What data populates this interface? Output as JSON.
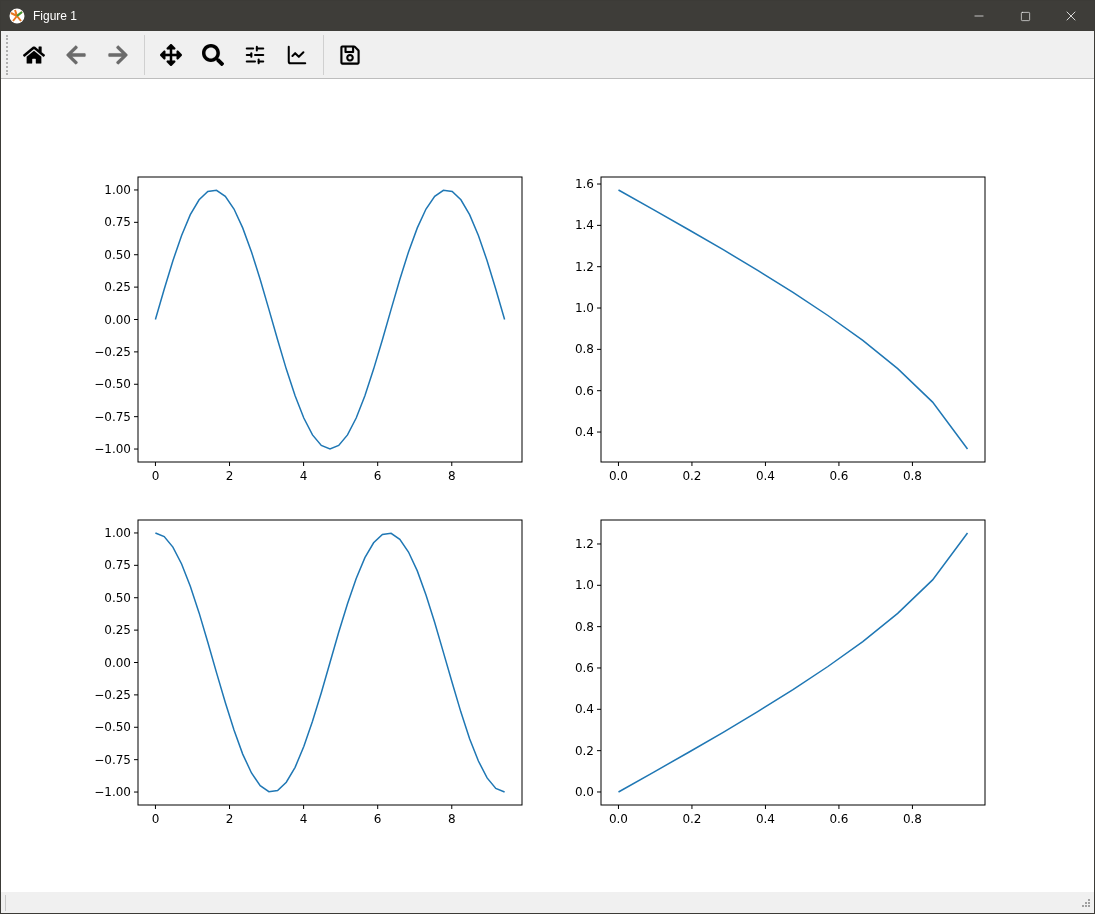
{
  "window": {
    "title": "Figure 1"
  },
  "toolbar": [
    {
      "kind": "home",
      "disabled": false
    },
    {
      "kind": "back",
      "disabled": true
    },
    {
      "kind": "forward",
      "disabled": true
    },
    {
      "kind": "separator"
    },
    {
      "kind": "pan",
      "disabled": false
    },
    {
      "kind": "zoom",
      "disabled": false
    },
    {
      "kind": "subplots",
      "disabled": false
    },
    {
      "kind": "axes",
      "disabled": false
    },
    {
      "kind": "separator"
    },
    {
      "kind": "save",
      "disabled": false
    }
  ],
  "plots": [
    {
      "chart_data": {
        "type": "line",
        "x": [
          0,
          0.236,
          0.471,
          0.707,
          0.942,
          1.178,
          1.414,
          1.649,
          1.885,
          2.121,
          2.356,
          2.592,
          2.827,
          3.063,
          3.299,
          3.534,
          3.77,
          4.006,
          4.241,
          4.477,
          4.712,
          4.948,
          5.184,
          5.419,
          5.655,
          5.89,
          6.126,
          6.362,
          6.597,
          6.833,
          7.069,
          7.304,
          7.54,
          7.775,
          8.011,
          8.247,
          8.482,
          8.718,
          8.954,
          9.189,
          9.425
        ],
        "series": [
          {
            "color": "#1f77b4",
            "values": [
              0,
              0.233,
              0.454,
              0.649,
              0.809,
              0.924,
              0.988,
              0.997,
              0.951,
              0.853,
              0.707,
              0.522,
              0.309,
              0.078,
              -0.156,
              -0.383,
              -0.588,
              -0.76,
              -0.891,
              -0.972,
              -1,
              -0.972,
              -0.891,
              -0.76,
              -0.588,
              -0.383,
              -0.156,
              0.078,
              0.309,
              0.522,
              0.707,
              0.853,
              0.951,
              0.997,
              0.988,
              0.924,
              0.809,
              0.649,
              0.454,
              0.233,
              0
            ]
          }
        ],
        "xlim": [
          -0.471,
          9.896
        ],
        "ylim": [
          -1.1,
          1.1
        ],
        "xticks": [
          {
            "value": 0,
            "label": "0"
          },
          {
            "value": 2,
            "label": "2"
          },
          {
            "value": 4,
            "label": "4"
          },
          {
            "value": 6,
            "label": "6"
          },
          {
            "value": 8,
            "label": "8"
          }
        ],
        "yticks": [
          {
            "value": 1,
            "label": "1.00"
          },
          {
            "value": 0.75,
            "label": "0.75"
          },
          {
            "value": 0.5,
            "label": "0.50"
          },
          {
            "value": 0.25,
            "label": "0.25"
          },
          {
            "value": 0,
            "label": "0.00"
          },
          {
            "value": -0.25,
            "label": "−0.25"
          },
          {
            "value": -0.5,
            "label": "−0.50"
          },
          {
            "value": -0.75,
            "label": "−0.75"
          },
          {
            "value": -1,
            "label": "−1.00"
          }
        ]
      }
    },
    {
      "chart_data": {
        "type": "line",
        "x": [
          0,
          0.095,
          0.19,
          0.285,
          0.38,
          0.475,
          0.57,
          0.665,
          0.76,
          0.855,
          0.95
        ],
        "series": [
          {
            "color": "#1f77b4",
            "values": [
              1.571,
              1.476,
              1.38,
              1.282,
              1.181,
              1.076,
              0.964,
              0.844,
              0.707,
              0.545,
              0.318
            ]
          }
        ],
        "xlim": [
          -0.0475,
          0.9975
        ],
        "ylim": [
          0.255,
          1.634
        ],
        "xticks": [
          {
            "value": 0,
            "label": "0.0"
          },
          {
            "value": 0.2,
            "label": "0.2"
          },
          {
            "value": 0.4,
            "label": "0.4"
          },
          {
            "value": 0.6,
            "label": "0.6"
          },
          {
            "value": 0.8,
            "label": "0.8"
          }
        ],
        "yticks": [
          {
            "value": 1.6,
            "label": "1.6"
          },
          {
            "value": 1.4,
            "label": "1.4"
          },
          {
            "value": 1.2,
            "label": "1.2"
          },
          {
            "value": 1.0,
            "label": "1.0"
          },
          {
            "value": 0.8,
            "label": "0.8"
          },
          {
            "value": 0.6,
            "label": "0.6"
          },
          {
            "value": 0.4,
            "label": "0.4"
          }
        ]
      }
    },
    {
      "chart_data": {
        "type": "line",
        "x": [
          0,
          0.236,
          0.471,
          0.707,
          0.942,
          1.178,
          1.414,
          1.649,
          1.885,
          2.121,
          2.356,
          2.592,
          2.827,
          3.063,
          3.299,
          3.534,
          3.77,
          4.006,
          4.241,
          4.477,
          4.712,
          4.948,
          5.184,
          5.419,
          5.655,
          5.89,
          6.126,
          6.362,
          6.597,
          6.833,
          7.069,
          7.304,
          7.54,
          7.775,
          8.011,
          8.247,
          8.482,
          8.718,
          8.954,
          9.189,
          9.425
        ],
        "series": [
          {
            "color": "#1f77b4",
            "values": [
              1,
              0.972,
              0.891,
              0.76,
              0.588,
              0.383,
              0.156,
              -0.078,
              -0.309,
              -0.522,
              -0.707,
              -0.853,
              -0.951,
              -0.997,
              -0.988,
              -0.924,
              -0.809,
              -0.649,
              -0.454,
              -0.233,
              0,
              0.233,
              0.454,
              0.649,
              0.809,
              0.924,
              0.988,
              0.997,
              0.951,
              0.853,
              0.707,
              0.522,
              0.309,
              0.078,
              -0.156,
              -0.383,
              -0.588,
              -0.76,
              -0.891,
              -0.972,
              -1
            ]
          }
        ],
        "xlim": [
          -0.471,
          9.896
        ],
        "ylim": [
          -1.1,
          1.1
        ],
        "xticks": [
          {
            "value": 0,
            "label": "0"
          },
          {
            "value": 2,
            "label": "2"
          },
          {
            "value": 4,
            "label": "4"
          },
          {
            "value": 6,
            "label": "6"
          },
          {
            "value": 8,
            "label": "8"
          }
        ],
        "yticks": [
          {
            "value": 1,
            "label": "1.00"
          },
          {
            "value": 0.75,
            "label": "0.75"
          },
          {
            "value": 0.5,
            "label": "0.50"
          },
          {
            "value": 0.25,
            "label": "0.25"
          },
          {
            "value": 0,
            "label": "0.00"
          },
          {
            "value": -0.25,
            "label": "−0.25"
          },
          {
            "value": -0.5,
            "label": "−0.50"
          },
          {
            "value": -0.75,
            "label": "−0.75"
          },
          {
            "value": -1,
            "label": "−1.00"
          }
        ]
      }
    },
    {
      "chart_data": {
        "type": "line",
        "x": [
          0,
          0.095,
          0.19,
          0.285,
          0.38,
          0.475,
          0.57,
          0.665,
          0.76,
          0.855,
          0.95
        ],
        "series": [
          {
            "color": "#1f77b4",
            "values": [
              0,
              0.095,
              0.191,
              0.289,
              0.39,
              0.495,
              0.607,
              0.727,
              0.864,
              1.026,
              1.253
            ]
          }
        ],
        "xlim": [
          -0.0475,
          0.9975
        ],
        "ylim": [
          -0.063,
          1.316
        ],
        "xticks": [
          {
            "value": 0,
            "label": "0.0"
          },
          {
            "value": 0.2,
            "label": "0.2"
          },
          {
            "value": 0.4,
            "label": "0.4"
          },
          {
            "value": 0.6,
            "label": "0.6"
          },
          {
            "value": 0.8,
            "label": "0.8"
          }
        ],
        "yticks": [
          {
            "value": 1.2,
            "label": "1.2"
          },
          {
            "value": 1.0,
            "label": "1.0"
          },
          {
            "value": 0.8,
            "label": "0.8"
          },
          {
            "value": 0.6,
            "label": "0.6"
          },
          {
            "value": 0.4,
            "label": "0.4"
          },
          {
            "value": 0.2,
            "label": "0.2"
          },
          {
            "value": 0.0,
            "label": "0.0"
          }
        ]
      }
    }
  ]
}
